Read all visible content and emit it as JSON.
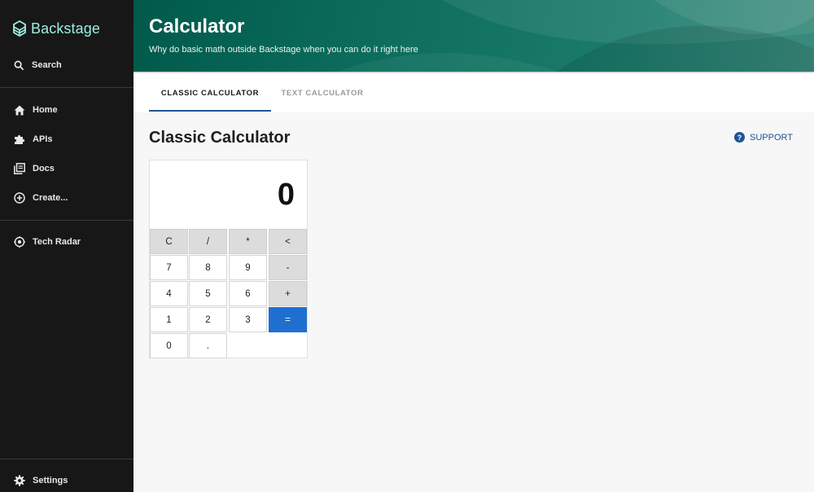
{
  "sidebar": {
    "logo": "Backstage",
    "search": "Search",
    "items": [
      "Home",
      "APIs",
      "Docs",
      "Create..."
    ],
    "tech_radar": "Tech Radar",
    "settings": "Settings"
  },
  "header": {
    "title": "Calculator",
    "subtitle": "Why do basic math outside Backstage when you can do it right here"
  },
  "tabs": [
    "CLASSIC CALCULATOR",
    "TEXT CALCULATOR"
  ],
  "active_tab": "CLASSIC CALCULATOR",
  "content": {
    "title": "Classic Calculator",
    "support": "SUPPORT"
  },
  "calculator": {
    "display": "0",
    "keys": {
      "clear": "C",
      "divide": "/",
      "multiply": "*",
      "backspace": "<",
      "seven": "7",
      "eight": "8",
      "nine": "9",
      "minus": "-",
      "four": "4",
      "five": "5",
      "six": "6",
      "plus": "+",
      "one": "1",
      "two": "2",
      "three": "3",
      "equals": "=",
      "zero": "0",
      "dot": "."
    }
  },
  "colors": {
    "sidebar_bg": "#171717",
    "logo": "#9bf0e1",
    "header": "#0e6f5e",
    "accent": "#1f5493",
    "equals": "#1f6fd1"
  }
}
